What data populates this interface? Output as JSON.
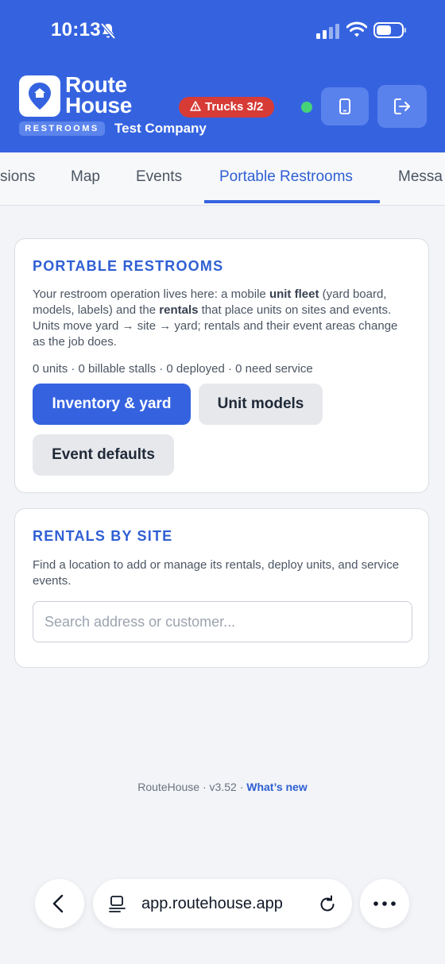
{
  "status_bar": {
    "time": "10:13"
  },
  "header": {
    "brand_line1": "Route",
    "brand_line2": "House",
    "tag": "RESTROOMS",
    "company": "Test Company",
    "trucks_badge": "Trucks 3/2",
    "accent": "#3563e0",
    "alert_color": "#d63b36",
    "online_color": "#45d37a"
  },
  "tabs": [
    {
      "label": "sions"
    },
    {
      "label": "Map"
    },
    {
      "label": "Events"
    },
    {
      "label": "Portable Restrooms",
      "active": true
    },
    {
      "label": "Messa"
    }
  ],
  "restrooms_card": {
    "title": "PORTABLE RESTROOMS",
    "text_1": "Your restroom operation lives here: a mobile ",
    "bold_1": "unit fleet",
    "text_2": " (yard board, models, labels) and the ",
    "bold_2": "rentals",
    "text_3": " that place units on sites and events. Units move yard → site → yard; rentals and their event areas change as the job does.",
    "stats": "0 units · 0 billable stalls · 0 deployed · 0 need service",
    "buttons": {
      "inventory": "Inventory & yard",
      "models": "Unit models",
      "defaults": "Event defaults"
    }
  },
  "rentals_card": {
    "title": "RENTALS BY SITE",
    "text": "Find a location to add or manage its rentals, deploy units, and service events.",
    "search_placeholder": "Search address or customer..."
  },
  "footer": {
    "app": "RouteHouse",
    "version": "v3.52",
    "whats_new": "What’s new"
  },
  "browser": {
    "url": "app.routehouse.app"
  }
}
